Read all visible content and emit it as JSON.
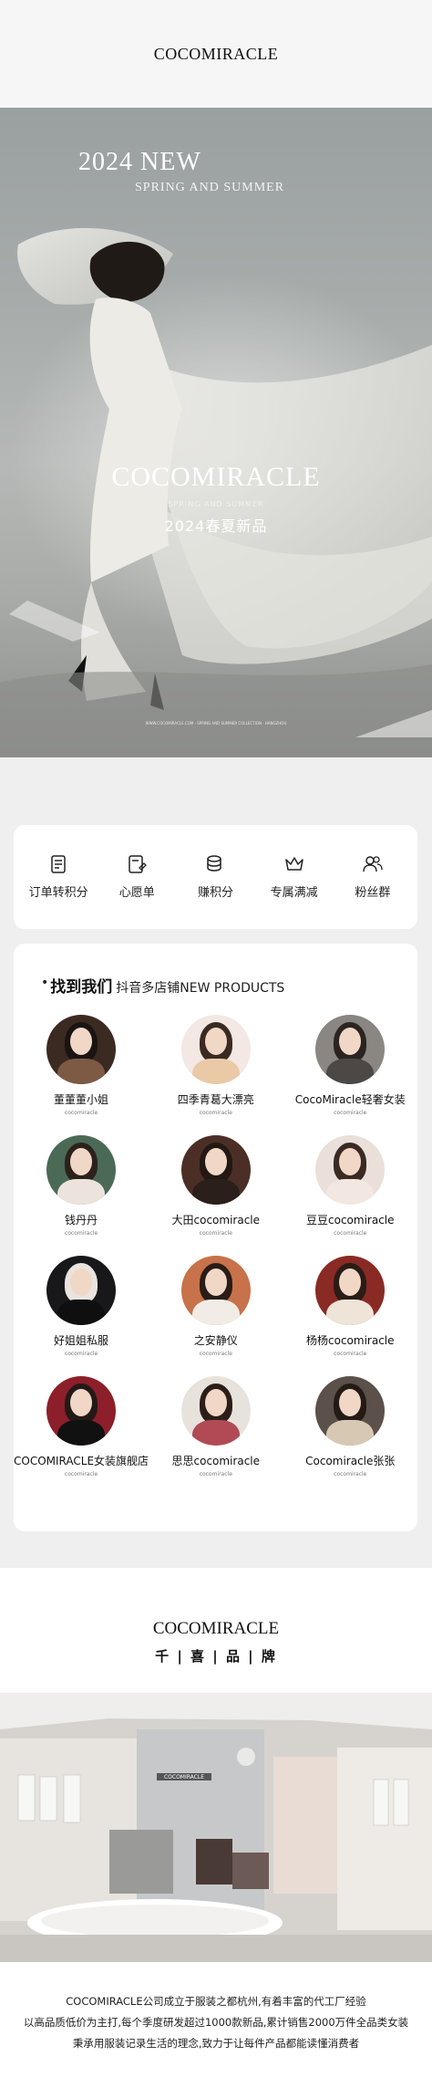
{
  "header": {
    "brand": "COCOMIRACLE"
  },
  "hero": {
    "year": "2024 NEW",
    "season": "SPRING AND SUMMER",
    "logo": "COCOMIRACLE",
    "sub": "SPRING AND SUMMER",
    "title_cn": "2024春夏新品",
    "fine_print": "WWW.COCOMIRACLE.COM · SPRING AND SUMMER COLLECTION · HANGZHOU"
  },
  "menu": [
    {
      "label": "订单转积分",
      "icon": "order-icon"
    },
    {
      "label": "心愿单",
      "icon": "wishlist-icon"
    },
    {
      "label": "赚积分",
      "icon": "points-icon"
    },
    {
      "label": "专属满减",
      "icon": "crown-icon"
    },
    {
      "label": "粉丝群",
      "icon": "group-icon"
    }
  ],
  "stores": {
    "title_main": "找到我们",
    "title_sub": "抖音多店铺NEW PRODUCTS",
    "items": [
      {
        "name": "董董董小姐",
        "tag": "cocomiracle",
        "colors": [
          "#3b2a22",
          "#1a1412",
          "#7d5a44"
        ]
      },
      {
        "name": "四季青葛大漂亮",
        "tag": "cocomiracle",
        "colors": [
          "#f3e8e3",
          "#3a2a22",
          "#e9c9a6"
        ]
      },
      {
        "name": "CocoMiracle轻奢女装",
        "tag": "cocomiracle",
        "colors": [
          "#8a8682",
          "#2c2420",
          "#4c4846"
        ]
      },
      {
        "name": "钱丹丹",
        "tag": "cocomiracle",
        "colors": [
          "#4a6a56",
          "#2d211c",
          "#ece4dc"
        ]
      },
      {
        "name": "大田cocomiracle",
        "tag": "cocomiracle",
        "colors": [
          "#4b2f26",
          "#241813",
          "#2a1f1a"
        ]
      },
      {
        "name": "豆豆cocomiracle",
        "tag": "cocomiracle",
        "colors": [
          "#eadfd9",
          "#3a2a24",
          "#f2e7e1"
        ]
      },
      {
        "name": "好姐姐私服",
        "tag": "cocomiracle",
        "colors": [
          "#18181a",
          "#e9e4df",
          "#0f0f10"
        ]
      },
      {
        "name": "之安静仪",
        "tag": "cocomiracle",
        "colors": [
          "#c7724a",
          "#2a1c16",
          "#f2ece6"
        ]
      },
      {
        "name": "杨杨cocomiracle",
        "tag": "cocomiracle",
        "colors": [
          "#8a2a24",
          "#2a1c16",
          "#eee5d8"
        ]
      },
      {
        "name": "COCOMIRACLE女装旗舰店",
        "tag": "cocomiracle",
        "colors": [
          "#8c1f2a",
          "#231a18",
          "#111111"
        ]
      },
      {
        "name": "思思cocomiracle",
        "tag": "cocomiracle",
        "colors": [
          "#e8e2dc",
          "#2b1e18",
          "#b04a55"
        ]
      },
      {
        "name": "Cocomiracle张张",
        "tag": "cocomiracle",
        "colors": [
          "#5b514a",
          "#241a16",
          "#d7c8b4"
        ]
      }
    ]
  },
  "brand_section": {
    "brand": "COCOMIRACLE",
    "brand_cn": "千 | 喜 | 品 | 牌",
    "showroom_sign": "COCOMIRACLE",
    "about_lines": [
      "COCOMIRACLE公司成立于服装之都杭州,有着丰富的代工厂经验",
      "以高品质低价为主打,每个季度研发超过1000款新品,累计销售2000万件全品类女装",
      "秉承用服装记录生活的理念,致力于让每件产品都能读懂消费者"
    ]
  }
}
